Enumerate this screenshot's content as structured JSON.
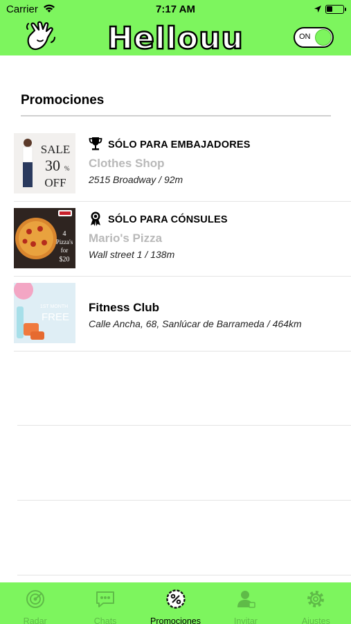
{
  "status_bar": {
    "carrier": "Carrier",
    "time": "7:17 AM"
  },
  "header": {
    "brand": "Hellouu",
    "toggle_label": "ON",
    "toggle_state": "on",
    "accent_color": "#7df55e"
  },
  "section": {
    "title": "Promociones"
  },
  "promotions": [
    {
      "badge_icon": "trophy-icon",
      "badge": "SÓLO PARA EMBAJADORES",
      "name": "Clothes Shop",
      "address": "2515 Broadway / 92m",
      "image": {
        "line1": "SALE",
        "line2": "30",
        "line2_suffix": "%",
        "line3": "OFF"
      }
    },
    {
      "badge_icon": "ribbon-award-icon",
      "badge": "SÓLO PARA CÓNSULES",
      "name": "Mario's Pizza",
      "address": "Wall street 1 / 138m",
      "image": {
        "line1": "4",
        "line2": "Pizza's",
        "line3": "for",
        "line4": "$20"
      }
    },
    {
      "badge_icon": "",
      "badge": "",
      "name": "Fitness Club",
      "address": "Calle Ancha, 68, Sanlúcar de Barrameda / 464km",
      "image": {
        "line1": "1ST MONTH",
        "line2": "FREE"
      }
    }
  ],
  "tabs": [
    {
      "label": "Radar",
      "icon": "radar-icon",
      "active": false
    },
    {
      "label": "Chats",
      "icon": "chat-icon",
      "active": false
    },
    {
      "label": "Promociones",
      "icon": "promo-percent-icon",
      "active": true
    },
    {
      "label": "Invitar",
      "icon": "invite-user-icon",
      "active": false
    },
    {
      "label": "Ajustes",
      "icon": "gear-icon",
      "active": false
    }
  ]
}
